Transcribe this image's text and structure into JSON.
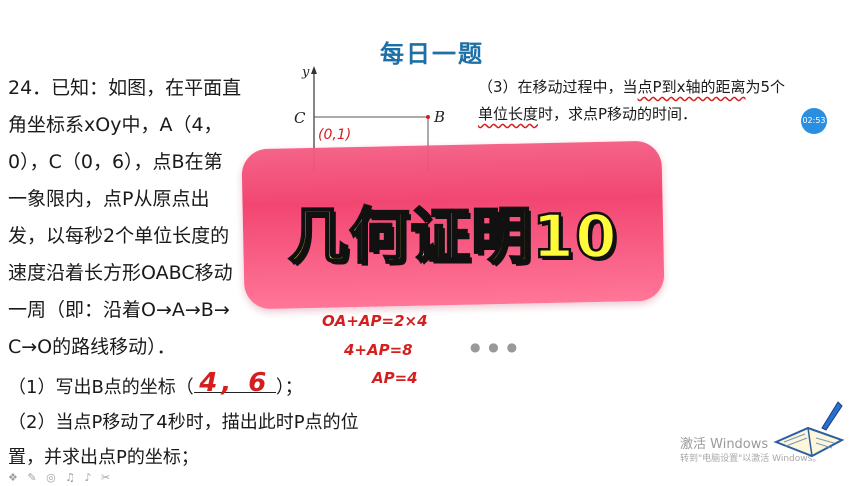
{
  "header": {
    "title": "每日一题"
  },
  "problem": {
    "lines": [
      "24．已知：如图，在平面直",
      "角坐标系xOy中，A（4，",
      "0），C（0，6），点B在第",
      "一象限内，点P从原点出",
      "发，以每秒2个单位长度的",
      "速度沿着长方形OABC移动",
      "一周（即：沿着O→A→B→",
      "C→O的路线移动）．"
    ]
  },
  "part3": {
    "line1_pre": "（3）在移动过程中，当",
    "line1_mark": "点P到x轴的距离",
    "line1_post": "为5个",
    "line2_mark": "单位长度",
    "line2_post": "时，求点P移动的时间．"
  },
  "subquestions": {
    "q1_pre": "（1）写出B点的坐标（",
    "q1_answer": "4, 6",
    "q1_post": "）；",
    "q2_line1": "（2）当点P移动了4秒时，描出此时P点的位",
    "q2_line2": "置，并求出点P的坐标；"
  },
  "figure": {
    "axis_y": "y",
    "label_c": "C",
    "label_b": "B",
    "note": "(0,1)"
  },
  "handwriting": {
    "work1": "OA+AP=2×4",
    "work2": "4+AP=8",
    "work3": "AP=4"
  },
  "banner": {
    "text": "几何证明10"
  },
  "timer": {
    "text": "02:53"
  },
  "watermark": {
    "title": "激活 Windows",
    "subtitle": "转到\"电脑设置\"以激活 Windows。"
  },
  "colors": {
    "title_blue": "#1d6fa5",
    "ink_red": "#d41f1f",
    "banner_pink": "#f23d6b",
    "banner_text": "#fffb3a"
  }
}
